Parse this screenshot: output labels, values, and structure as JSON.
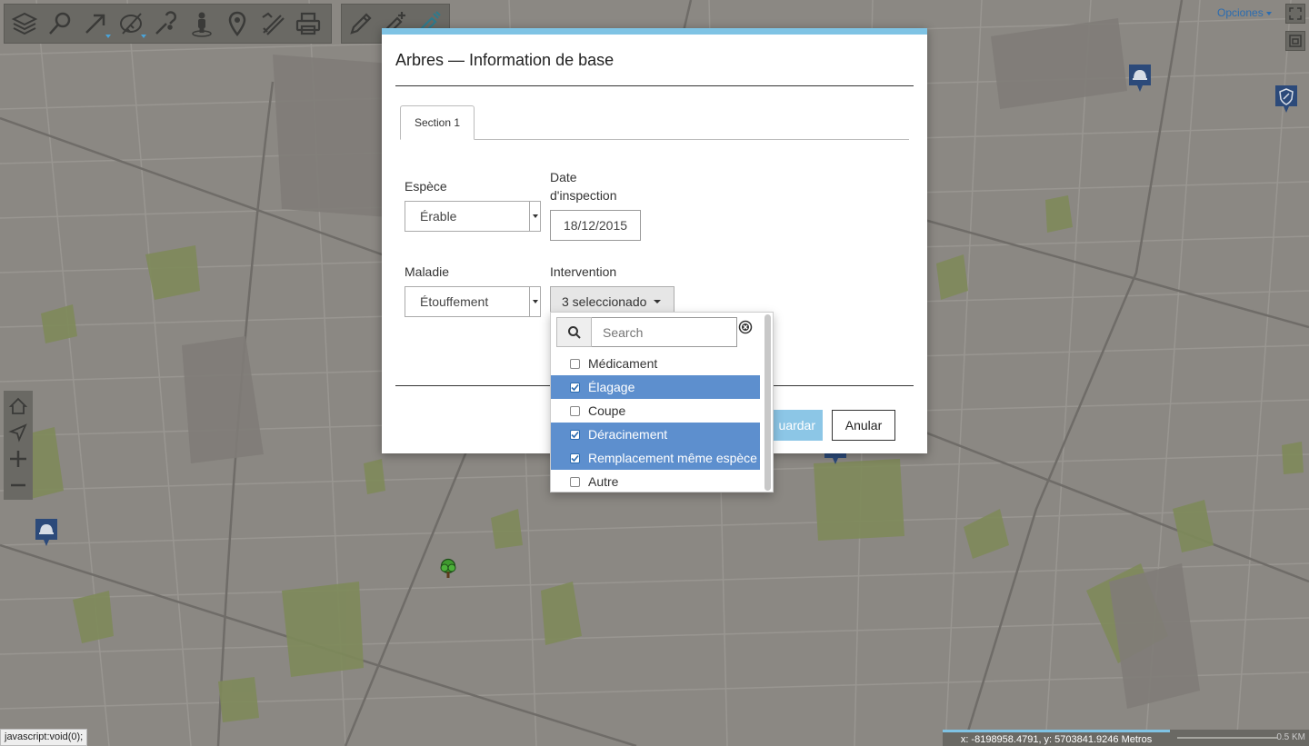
{
  "toolbar": {
    "main_buttons": [
      "layers-icon",
      "search-icon",
      "select-arrow-icon",
      "measure-icon",
      "info-icon",
      "street-view-icon",
      "location-pin-icon",
      "draw-tools-icon",
      "print-icon"
    ],
    "edit_buttons": [
      "pencil-icon",
      "add-feature-icon",
      "edit-feature-icon"
    ],
    "icon_color": "#3a3a38",
    "accent": "#4aa3d8"
  },
  "top_right": {
    "options_label": "Opciones"
  },
  "modal": {
    "title": "Arbres — Information de base",
    "tab_label": "Section 1",
    "fields": {
      "espece_label": "Espèce",
      "espece_value": "Érable",
      "date_label_line1": "Date",
      "date_label_line2": "d'inspection",
      "date_value": "18/12/2015",
      "maladie_label": "Maladie",
      "maladie_value": "Étouffement",
      "intervention_label": "Intervention",
      "intervention_value": "3 seleccionado"
    },
    "save_label": "Guardar",
    "save_visible_text": "uardar",
    "cancel_label": "Anular"
  },
  "dropdown": {
    "search_placeholder": "Search",
    "options": [
      {
        "label": "Médicament",
        "selected": false
      },
      {
        "label": "Élagage",
        "selected": true
      },
      {
        "label": "Coupe",
        "selected": false
      },
      {
        "label": "Déracinement",
        "selected": true
      },
      {
        "label": "Remplacement même espèce",
        "selected": true
      },
      {
        "label": "Autre",
        "selected": false
      }
    ],
    "selected_color": "#5d8fce"
  },
  "status": {
    "link_text": "javascript:void(0);",
    "coordinates": "x: -8198958.4791, y: 5703841.9246 Metros",
    "scale_label": "0.5 KM"
  },
  "map": {
    "background": "#8b8883",
    "park_color": "#7e8a5a",
    "marker_color": "#2c4a7a"
  }
}
